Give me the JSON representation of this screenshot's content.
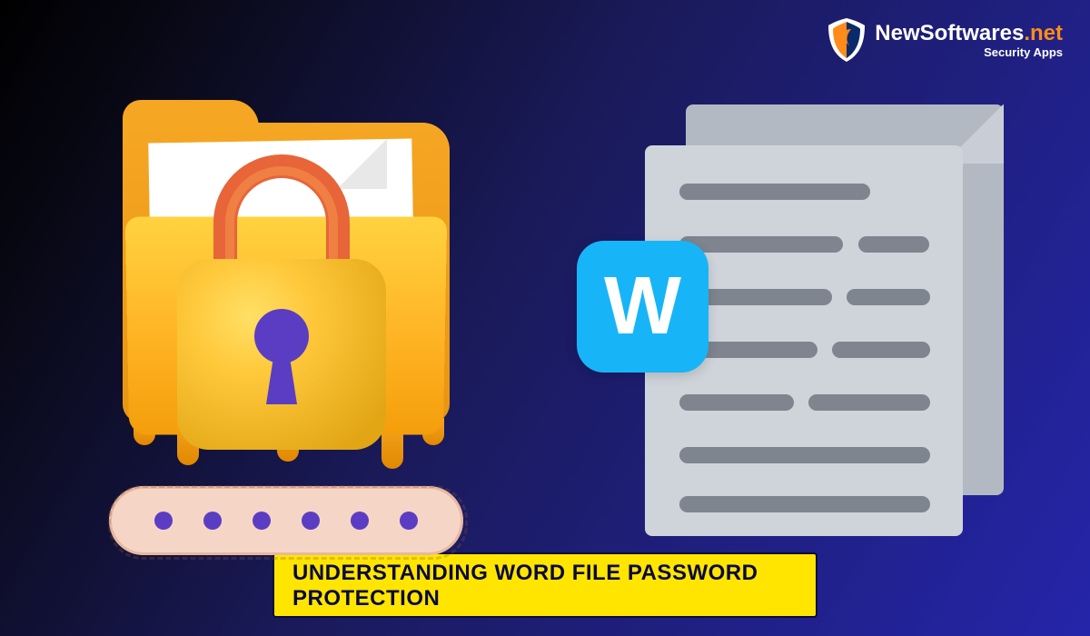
{
  "logo": {
    "brand_prefix": "NewSoftwares",
    "brand_suffix": ".net",
    "tagline": "Security Apps"
  },
  "left_graphic": {
    "name": "locked-folder-with-password",
    "password_dots_count": 6
  },
  "right_graphic": {
    "name": "word-document-pages",
    "word_badge_letter": "W"
  },
  "caption": {
    "text": "UNDERSTANDING WORD FILE PASSWORD PROTECTION"
  },
  "colors": {
    "accent_yellow": "#ffe500",
    "accent_orange": "#ff8c1a",
    "w_badge": "#17b5f7",
    "keyhole_purple": "#5b3dc4"
  }
}
